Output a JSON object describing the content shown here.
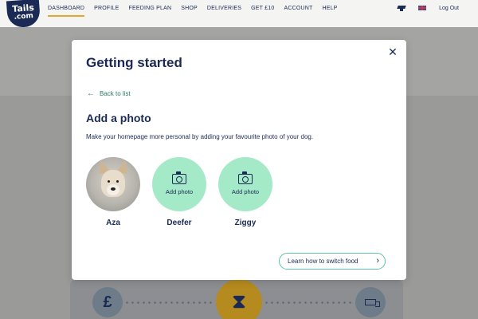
{
  "logo": {
    "line1": "Tails",
    "line2": ".com"
  },
  "nav": {
    "items": [
      {
        "label": "DASHBOARD",
        "active": true
      },
      {
        "label": "PROFILE"
      },
      {
        "label": "FEEDING PLAN"
      },
      {
        "label": "SHOP"
      },
      {
        "label": "DELIVERIES"
      },
      {
        "label": "GET £10"
      },
      {
        "label": "ACCOUNT"
      },
      {
        "label": "HELP"
      }
    ],
    "logout": "Log Out"
  },
  "modal": {
    "title": "Getting started",
    "back_link": "Back to list",
    "section_title": "Add a photo",
    "description": "Make your homepage more personal by adding your favourite photo of your dog.",
    "dogs": [
      {
        "name": "Aza",
        "has_photo": true
      },
      {
        "name": "Deefer",
        "action": "Add photo"
      },
      {
        "name": "Ziggy",
        "action": "Add photo"
      }
    ],
    "cta": "Learn how to switch food"
  },
  "steps": {
    "price_symbol": "£",
    "hourglass_symbol": "⧗"
  },
  "colors": {
    "navy": "#1b2a55",
    "mint": "#a5eac8",
    "accent": "#e0a82e",
    "link": "#2c7a6a"
  }
}
